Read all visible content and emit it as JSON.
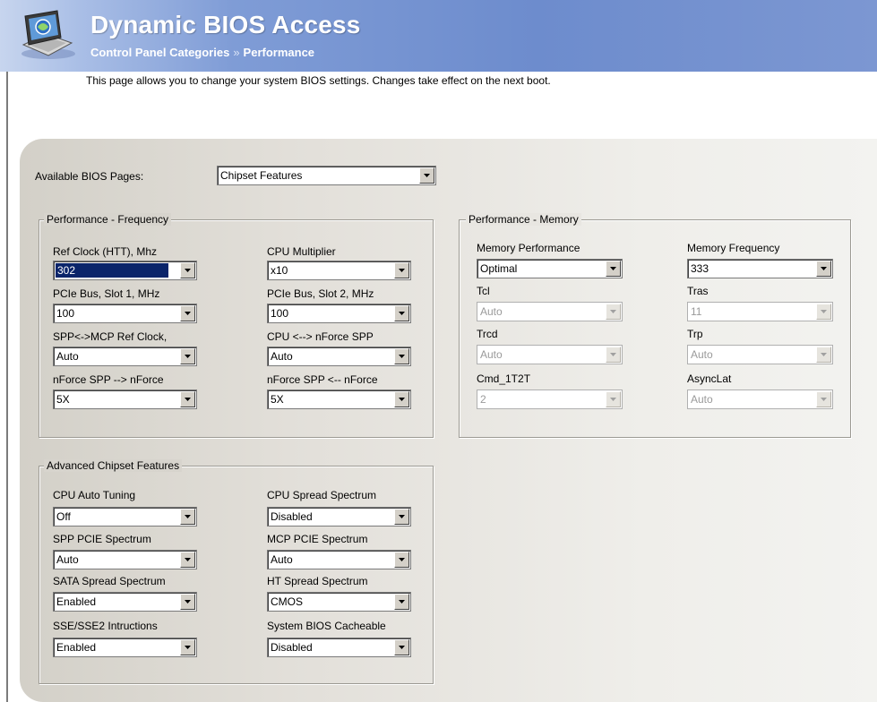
{
  "header": {
    "app_title": "Dynamic BIOS Access",
    "breadcrumb_root": "Control Panel Categories",
    "breadcrumb_separator": "»",
    "breadcrumb_current": "Performance",
    "icon": "computer-monitor-icon"
  },
  "intro_text": "This page allows you to change your system BIOS settings.  Changes take effect on the next boot.",
  "bios_pages": {
    "label": "Available BIOS Pages:",
    "value": "Chipset Features"
  },
  "perf_frequency": {
    "title": "Performance - Frequency",
    "fields": [
      {
        "label": "Ref Clock (HTT), Mhz",
        "value": "302"
      },
      {
        "label": "CPU Multiplier",
        "value": "x10"
      },
      {
        "label": "PCIe Bus, Slot 1, MHz",
        "value": "100"
      },
      {
        "label": "PCIe Bus, Slot 2, MHz",
        "value": "100"
      },
      {
        "label": "SPP<->MCP Ref Clock,",
        "value": "Auto"
      },
      {
        "label": "CPU <--> nForce SPP",
        "value": "Auto"
      },
      {
        "label": "nForce SPP --> nForce",
        "value": "5X"
      },
      {
        "label": "nForce SPP <-- nForce",
        "value": "5X"
      }
    ]
  },
  "perf_memory": {
    "title": "Performance - Memory",
    "fields": [
      {
        "label": "Memory Performance",
        "value": "Optimal",
        "enabled": true
      },
      {
        "label": "Memory Frequency",
        "value": "333",
        "enabled": true
      },
      {
        "label": "Tcl",
        "value": "Auto",
        "enabled": false
      },
      {
        "label": "Tras",
        "value": "11",
        "enabled": false
      },
      {
        "label": "Trcd",
        "value": "Auto",
        "enabled": false
      },
      {
        "label": "Trp",
        "value": "Auto",
        "enabled": false
      },
      {
        "label": "Cmd_1T2T",
        "value": "2",
        "enabled": false
      },
      {
        "label": "AsyncLat",
        "value": "Auto",
        "enabled": false
      }
    ]
  },
  "adv_chipset": {
    "title": "Advanced Chipset Features",
    "fields": [
      {
        "label": "CPU Auto Tuning",
        "value": "Off"
      },
      {
        "label": "CPU Spread Spectrum",
        "value": "Disabled"
      },
      {
        "label": "SPP PCIE Spectrum",
        "value": "Auto"
      },
      {
        "label": "MCP PCIE Spectrum",
        "value": "Auto"
      },
      {
        "label": "SATA Spread Spectrum",
        "value": "Enabled"
      },
      {
        "label": "HT Spread Spectrum",
        "value": "CMOS"
      },
      {
        "label": "SSE/SSE2 Intructions",
        "value": "Enabled"
      },
      {
        "label": "System BIOS Cacheable",
        "value": "Disabled"
      }
    ]
  },
  "colors": {
    "header_blue": "#6d8ccd",
    "panel_gray": "#d3d0c8",
    "selection_blue": "#0a246a"
  }
}
